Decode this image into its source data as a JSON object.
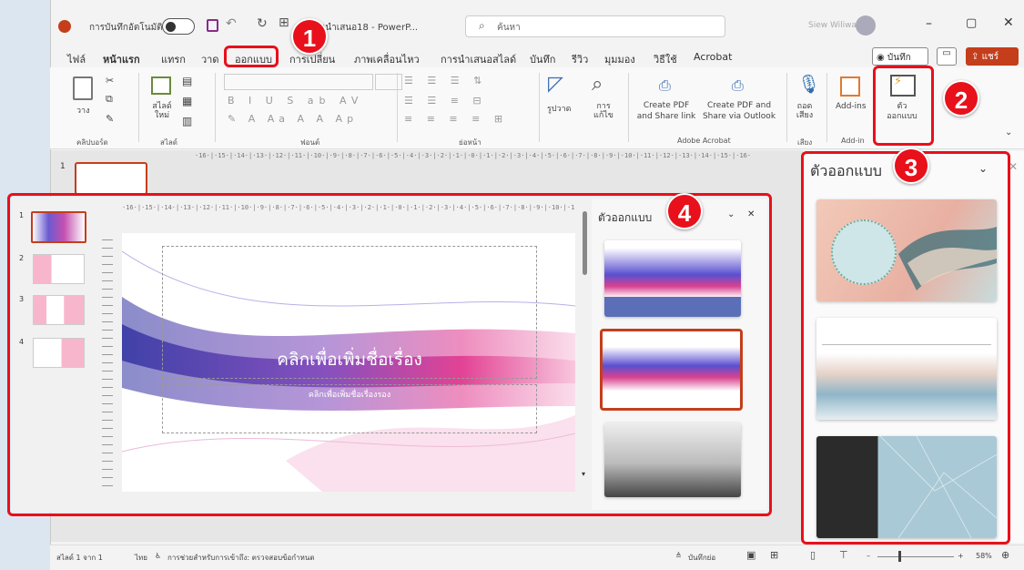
{
  "titlebar": {
    "autosave_label": "การบันทึกอัตโนมัติ",
    "file_title": "งานนำเสนอ18 - PowerP...",
    "search_placeholder": "ค้นหา",
    "user_name": "Siew Wiliwawse"
  },
  "menu": {
    "tabs": [
      "ไฟล์",
      "หน้าแรก",
      "แทรก",
      "วาด",
      "ออกแบบ",
      "การเปลี่ยน",
      "ภาพเคลื่อนไหว",
      "การนำเสนอสไลด์",
      "บันทึก",
      "รีวิว",
      "มุมมอง",
      "วิธีใช้",
      "Acrobat"
    ],
    "record_button": "บันทึก",
    "share_button": "แชร์"
  },
  "ribbon": {
    "paste": "วาง",
    "new_slide": "สไลด์ใหม่",
    "draw_shape": "รูปวาด",
    "find_replace": "การแก้ไข",
    "create_pdf": "Create PDF and Share link",
    "create_pdf_outlook": "Create PDF and Share via Outlook",
    "dictate": "ถอดเสียง",
    "addins": "Add-ins",
    "designer": "ตัวออกแบบ",
    "groups": {
      "clipboard": "คลิปบอร์ด",
      "slides": "สไลด์",
      "font": "ฟอนต์",
      "paragraph": "ย่อหน้า",
      "adobe": "Adobe Acrobat",
      "voice": "เสียง",
      "addin": "Add-in"
    }
  },
  "ruler_text": "·16·|·15·|·14·|·13·|·12·|·11·|·10·|·9·|·8·|·7·|·6·|·5·|·4·|·3·|·2·|·1·|·0·|·1·|·2·|·3·|·4·|·5·|·6·|·7·|·8·|·9·|·10·|·11·|·12·|·13·|·14·|·15·|·16·",
  "slide": {
    "title": "คลิกเพื่อเพิ่มชื่อเรื่อง",
    "subtitle": "คลิกเพื่อเพิ่มชื่อเรื่องรอง",
    "numbers": [
      "1",
      "2",
      "3",
      "4"
    ]
  },
  "designer": {
    "title": "ตัวออกแบบ",
    "title_small": "ตัวออกแบบ"
  },
  "badges": [
    "1",
    "2",
    "3",
    "4"
  ],
  "status": {
    "slide_of": "สไลด์ 1 จาก 1",
    "language": "ไทย",
    "accessibility": "การช่วยสำหรับการเข้าถึง: ตรวจสอบข้อกำหนด",
    "notes": "บันทึกย่อ",
    "zoom": "58%"
  },
  "colors": {
    "accent": "#c43e1c",
    "highlight": "#e8101b"
  }
}
